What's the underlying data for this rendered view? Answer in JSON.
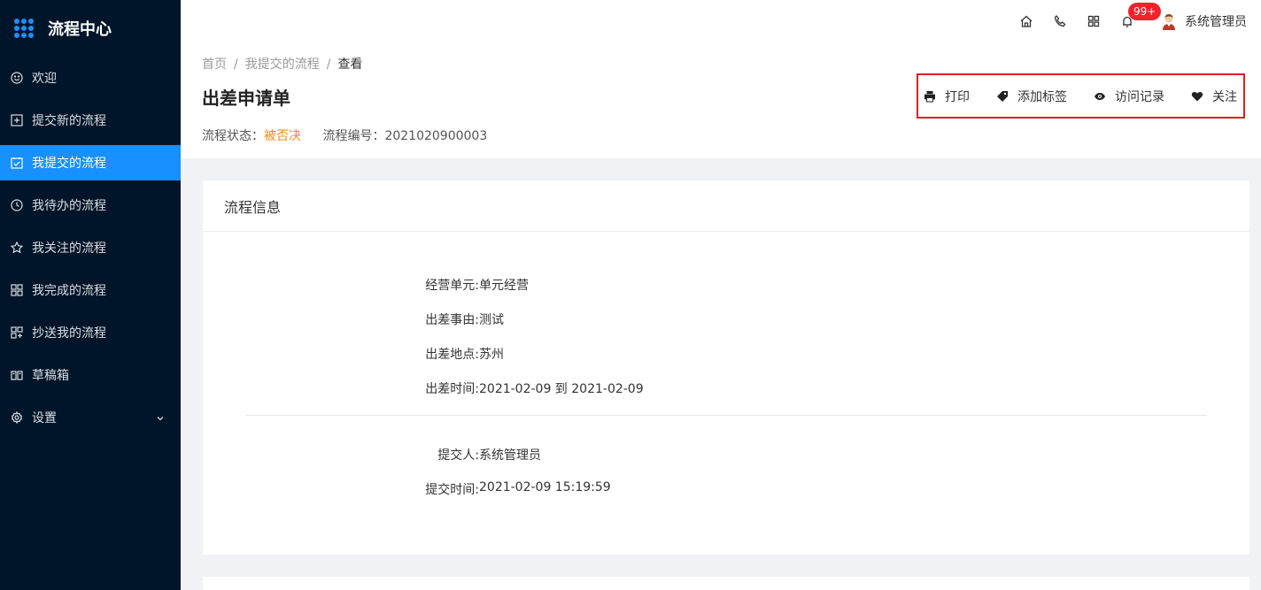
{
  "app": {
    "title": "流程中心"
  },
  "sidebar": {
    "items": [
      {
        "label": "欢迎",
        "icon": "smile-icon",
        "active": false
      },
      {
        "label": "提交新的流程",
        "icon": "plus-square-icon",
        "active": false
      },
      {
        "label": "我提交的流程",
        "icon": "check-square-icon",
        "active": true
      },
      {
        "label": "我待办的流程",
        "icon": "clock-icon",
        "active": false
      },
      {
        "label": "我关注的流程",
        "icon": "star-icon",
        "active": false
      },
      {
        "label": "我完成的流程",
        "icon": "appstore-icon",
        "active": false
      },
      {
        "label": "抄送我的流程",
        "icon": "copy-icon",
        "active": false
      },
      {
        "label": "草稿箱",
        "icon": "book-icon",
        "active": false
      },
      {
        "label": "设置",
        "icon": "gear-icon",
        "active": false,
        "expandable": true
      }
    ]
  },
  "header": {
    "icons": [
      "home-icon",
      "phone-icon",
      "appstore-icon",
      "bell-icon"
    ],
    "notification_badge": "99+",
    "user_name": "系统管理员"
  },
  "breadcrumb": {
    "home": "首页",
    "parent": "我提交的流程",
    "current": "查看"
  },
  "page": {
    "title": "出差申请单",
    "status_label": "流程状态：",
    "status_value": "被否决",
    "number_label": "流程编号：",
    "number_value": "2021020900003"
  },
  "actions": {
    "print": "打印",
    "add_tag": "添加标签",
    "visit_log": "访问记录",
    "follow": "关注"
  },
  "card": {
    "title": "流程信息",
    "fields": [
      {
        "label": "经营单元:",
        "value": "单元经营"
      },
      {
        "label": "出差事由:",
        "value": "测试"
      },
      {
        "label": "出差地点:",
        "value": "苏州"
      },
      {
        "label": "出差时间:",
        "value": "2021-02-09 到 2021-02-09"
      }
    ],
    "submit_fields": [
      {
        "label": "提交人:",
        "value": "系统管理员"
      },
      {
        "label": "提交时间:",
        "value": "2021-02-09 15:19:59"
      }
    ]
  },
  "colors": {
    "sidebar_bg": "#001529",
    "accent": "#1890ff",
    "status": "#fa8c16",
    "badge": "#f5222d",
    "highlight_border": "#e02020"
  }
}
